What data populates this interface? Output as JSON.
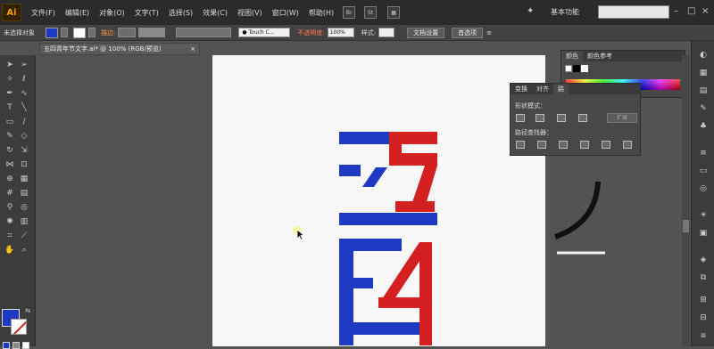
{
  "app": {
    "logo": "Ai"
  },
  "menu": [
    "文件(F)",
    "编辑(E)",
    "对象(O)",
    "文字(T)",
    "选择(S)",
    "效果(C)",
    "视图(V)",
    "窗口(W)",
    "帮助(H)"
  ],
  "menubar_buttons": [
    "Br",
    "St"
  ],
  "workspace": "基本功能",
  "control_bar": {
    "selection_status": "未选择对象",
    "fill_color": "#1f3ac2",
    "stroke_label": "描边:",
    "brush_label": "Touch C...",
    "opacity_label": "不透明度:",
    "opacity_value": "100%",
    "style_label": "样式:",
    "doc_setup_button": "文档设置",
    "prefs_button": "首选项"
  },
  "document_tab": {
    "title": "五四青年节文字.ai* @ 100% (RGB/预览)",
    "close": "×"
  },
  "color_panel": {
    "tabs": [
      "颜色",
      "颜色参考"
    ],
    "active": 0
  },
  "pathfinder_panel": {
    "tabs": [
      "变换",
      "对齐",
      "路"
    ],
    "shape_modes_label": "形状模式：",
    "pathfinders_label": "路径查找器：",
    "expand_button": "扩展"
  },
  "colors": {
    "blue": "#1f3ac2",
    "red": "#d42020"
  }
}
